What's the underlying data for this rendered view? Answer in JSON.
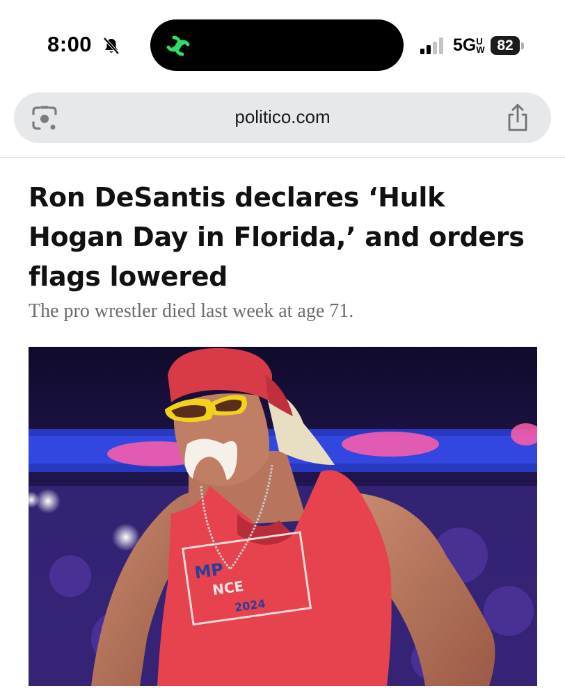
{
  "status_bar": {
    "time": "8:00",
    "network": "5G",
    "network_suffix": "UW",
    "battery": "82",
    "icons": [
      "bell-muted-icon",
      "app-activity-icon",
      "signal-icon"
    ]
  },
  "browser": {
    "url": "politico.com",
    "icons": [
      "google-lens-icon",
      "share-icon"
    ]
  },
  "article": {
    "headline": "Ron DeSantis declares ‘Hulk Hogan Day in Florida,’ and orders flags lowered",
    "subhead": "The pro wrestler died last week at age 71.",
    "image_shirt_text": [
      "MP",
      "NCE",
      "2024"
    ]
  },
  "colors": {
    "accent_green": "#2fdc6a",
    "url_bar": "#e7e8ea",
    "bandana_red": "#d83a48",
    "sunglasses_yellow": "#f2d21a",
    "arena_blue": "#2a3fd6"
  }
}
